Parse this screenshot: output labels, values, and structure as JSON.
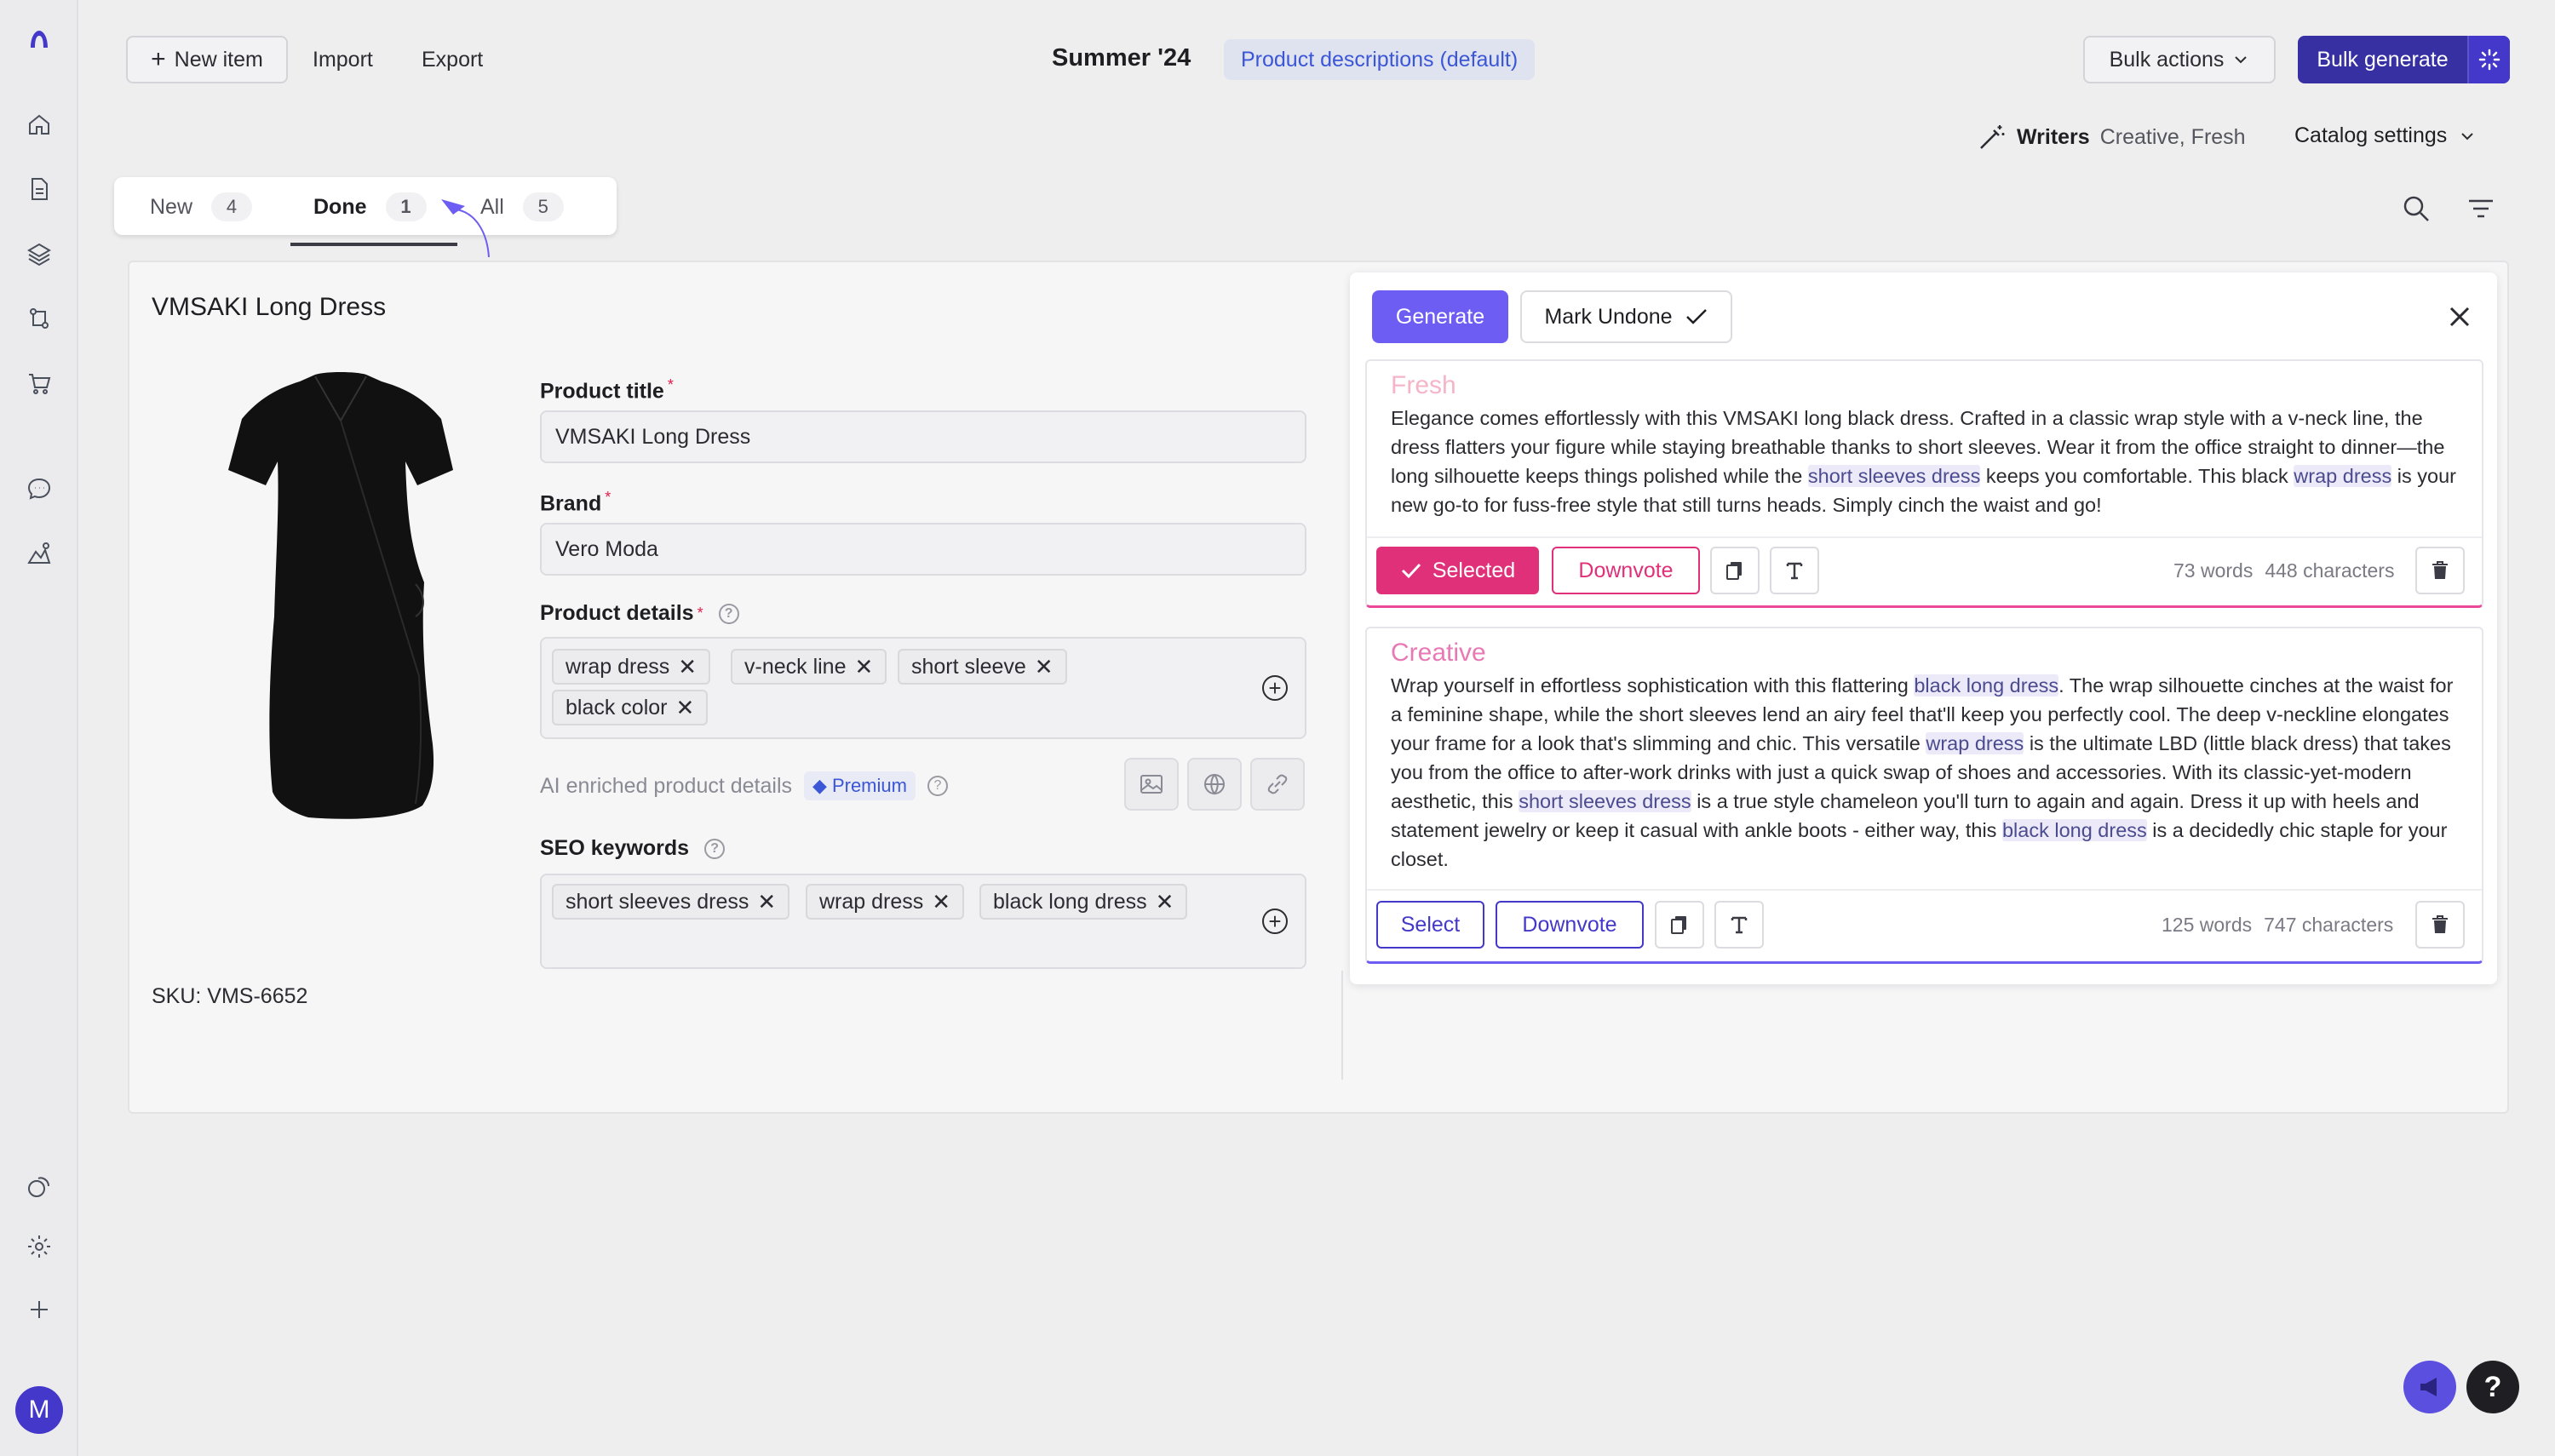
{
  "header": {
    "new_item_label": "New item",
    "import_label": "Import",
    "export_label": "Export",
    "collection_title": "Summer '24",
    "template_badge": "Product descriptions (default)",
    "bulk_actions_label": "Bulk actions",
    "bulk_generate_label": "Bulk generate"
  },
  "writers": {
    "label": "Writers",
    "value": "Creative, Fresh"
  },
  "catalog_settings_label": "Catalog settings",
  "tabs": [
    {
      "label": "New",
      "count": "4"
    },
    {
      "label": "Done",
      "count": "1"
    },
    {
      "label": "All",
      "count": "5"
    }
  ],
  "product": {
    "name": "VMSAKI Long Dress",
    "sku": "SKU: VMS-6652",
    "title_label": "Product title",
    "title_value": "VMSAKI Long Dress",
    "brand_label": "Brand",
    "brand_value": "Vero Moda",
    "details_label": "Product details",
    "details_tags": [
      "wrap dress",
      "v-neck line",
      "short sleeve",
      "black color"
    ],
    "ai_enriched_label": "AI enriched product details",
    "premium_label": "Premium",
    "seo_label": "SEO keywords",
    "seo_tags": [
      "short sleeves dress",
      "wrap dress",
      "black long dress"
    ]
  },
  "panel": {
    "generate_label": "Generate",
    "mark_undone_label": "Mark Undone",
    "fresh": {
      "title": "Fresh",
      "text_1": "Elegance comes effortlessly with this VMSAKI long black dress. Crafted in a classic wrap style with a v-neck line, the dress flatters your figure while staying breathable thanks to short sleeves. Wear it from the office straight to dinner—the long silhouette keeps things polished while the ",
      "hl_1": "short sleeves dress",
      "text_2": " keeps you comfortable. This black ",
      "hl_2": "wrap dress",
      "text_3": " is your new go-to for fuss-free style that still turns heads. Simply cinch the waist and go!",
      "selected_label": "Selected",
      "downvote_label": "Downvote",
      "words": "73 words",
      "chars": "448 characters"
    },
    "creative": {
      "title": "Creative",
      "text_1": "Wrap yourself in effortless sophistication with this flattering ",
      "hl_1": "black long dress",
      "text_2": ". The wrap silhouette cinches at the waist for a feminine shape, while the short sleeves lend an airy feel that'll keep you perfectly cool. The deep v-neckline elongates your frame for a look that's slimming and chic. This versatile ",
      "hl_2": "wrap dress",
      "text_3": " is the ultimate LBD (little black dress) that takes you from the office to after-work drinks with just a quick swap of shoes and accessories. With its classic-yet-modern aesthetic, this ",
      "hl_3": "short sleeves dress",
      "text_4": " is a true style chameleon you'll turn to again and again. Dress it up with heels and statement jewelry or keep it casual with ankle boots - either way, this ",
      "hl_4": "black long dress",
      "text_5": " is a decidedly chic staple for your closet.",
      "select_label": "Select",
      "downvote_label": "Downvote",
      "words": "125 words",
      "chars": "747 characters"
    }
  },
  "avatar_initial": "M",
  "help_label": "?",
  "colors": {
    "accent": "#4338ca",
    "generate": "#6d5df2",
    "selected": "#e1307a",
    "badge_blue": "#3b56d6"
  }
}
